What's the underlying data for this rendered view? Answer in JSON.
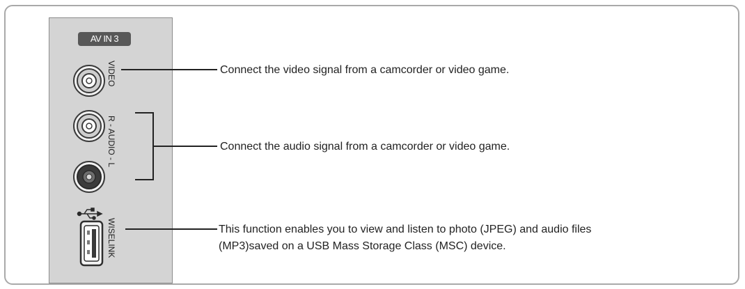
{
  "panel": {
    "badge": "AV IN 3",
    "labels": {
      "video": "VIDEO",
      "audio": "R - AUDIO - L",
      "usb": "WISELINK"
    }
  },
  "descriptions": {
    "video": "Connect the video signal from a camcorder or video game.",
    "audio": "Connect the audio signal from a camcorder or video game.",
    "usb_line1": "This function enables you to view and listen to photo (JPEG) and audio files",
    "usb_line2": "(MP3)saved on a USB Mass Storage Class (MSC) device."
  },
  "colors": {
    "panel": "#d4d4d4",
    "badge": "#585858",
    "frame": "#a9a9a9",
    "line": "#222222"
  },
  "icons": {
    "video_jack": "rca-jack-icon",
    "audio_right_jack": "rca-jack-icon",
    "audio_left_jack": "rca-jack-icon",
    "usb_port": "usb-port-icon",
    "usb_symbol": "usb-symbol-icon"
  }
}
